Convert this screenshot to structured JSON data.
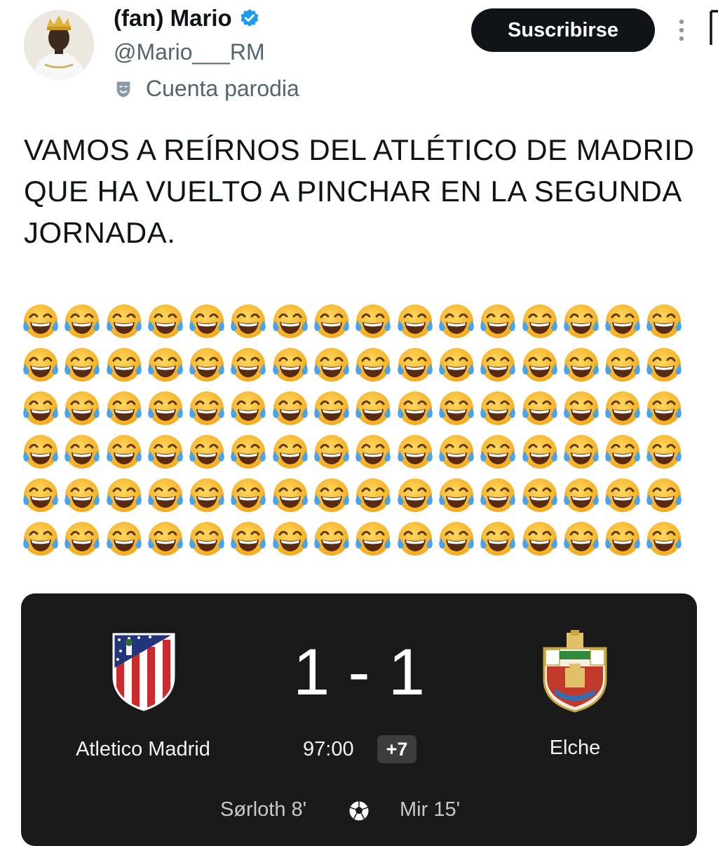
{
  "profile": {
    "display_name": "(fan) Mario",
    "handle": "@Mario___RM",
    "parody_label": "Cuenta parodia",
    "verified": true
  },
  "actions": {
    "subscribe_label": "Suscribirse"
  },
  "tweet": {
    "text": "VAMOS A REÍRNOS DEL ATLÉTICO DE MADRID QUE HA VUELTO A PINCHAR EN LA SEGUNDA JORNADA.",
    "emoji_glyph": "😂",
    "emoji_count": 96
  },
  "match": {
    "home_team": "Atletico Madrid",
    "away_team": "Elche",
    "score": "1 - 1",
    "clock": "97:00",
    "added_time": "+7",
    "home_scorer": "Sørloth 8'",
    "away_scorer": "Mir 15'"
  },
  "colors": {
    "verified_blue": "#1d9bf0",
    "card_background": "#1a1a1a",
    "button_background": "#0f1419"
  }
}
